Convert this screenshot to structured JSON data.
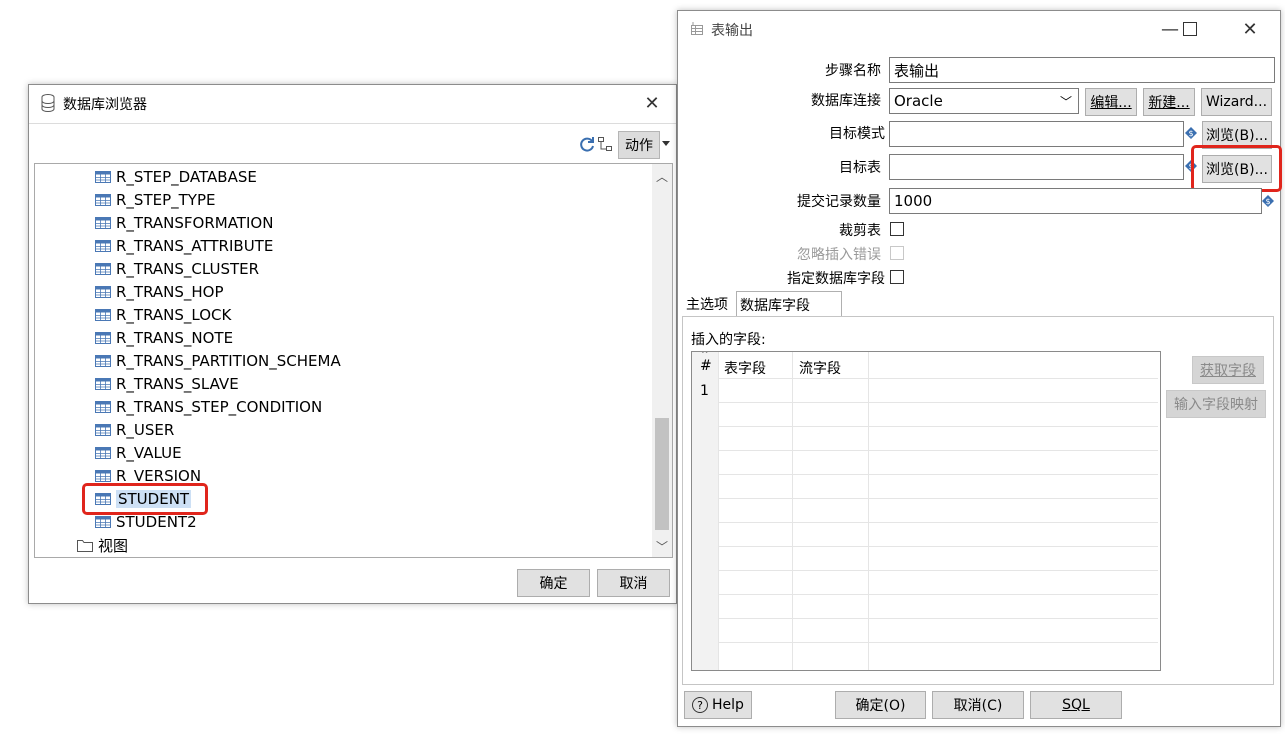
{
  "db_browser": {
    "title": "数据库浏览器",
    "action_label": "动作",
    "tables": [
      "R_STEP_DATABASE",
      "R_STEP_TYPE",
      "R_TRANSFORMATION",
      "R_TRANS_ATTRIBUTE",
      "R_TRANS_CLUSTER",
      "R_TRANS_HOP",
      "R_TRANS_LOCK",
      "R_TRANS_NOTE",
      "R_TRANS_PARTITION_SCHEMA",
      "R_TRANS_SLAVE",
      "R_TRANS_STEP_CONDITION",
      "R_USER",
      "R_VALUE",
      "R_VERSION",
      "STUDENT",
      "STUDENT2"
    ],
    "selected_table": "STUDENT",
    "views_label": "视图",
    "ok_label": "确定",
    "cancel_label": "取消"
  },
  "table_output": {
    "title": "表输出",
    "step_name_label": "步骤名称",
    "step_name_value": "表输出",
    "connection_label": "数据库连接",
    "connection_value": "Oracle",
    "edit_label": "编辑...",
    "new_label": "新建...",
    "wizard_label": "Wizard...",
    "schema_label": "目标模式",
    "schema_value": "",
    "browse_schema_label": "浏览(B)...",
    "table_label": "目标表",
    "table_value": "",
    "browse_table_label": "浏览(B)...",
    "commit_label": "提交记录数量",
    "commit_value": "1000",
    "truncate_label": "裁剪表",
    "ignore_errors_label": "忽略插入错误",
    "specify_fields_label": "指定数据库字段",
    "tabs": [
      "主选项",
      "数据库字段"
    ],
    "insert_fields_label": "插入的字段:",
    "columns": [
      "#",
      "表字段",
      "流字段"
    ],
    "rows": [
      [
        "1",
        "",
        ""
      ]
    ],
    "get_fields_label": "获取字段",
    "input_mapping_label": "输入字段映射",
    "help_label": "Help",
    "ok_label": "确定(O)",
    "cancel_label": "取消(C)",
    "sql_label": "SQL"
  }
}
